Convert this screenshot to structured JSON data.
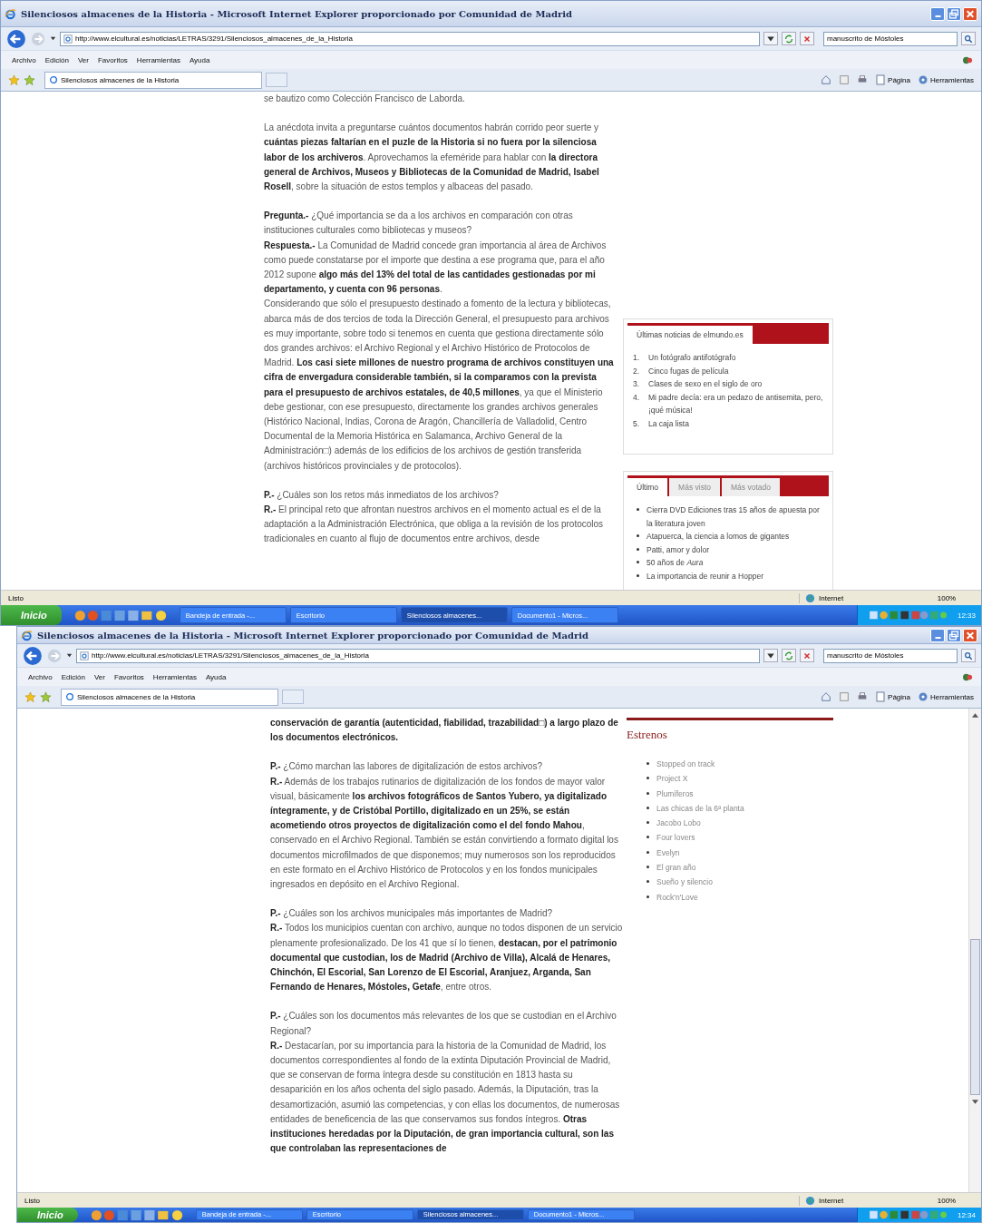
{
  "windows": [
    {
      "title": "Silenciosos almacenes de la Historia - Microsoft Internet Explorer proporcionado por Comunidad de Madrid",
      "address": "http://www.elcultural.es/noticias/LETRAS/3291/Silenciosos_almacenes_de_la_Historia",
      "search": "manuscrito de Móstoles",
      "menu": [
        "Archivo",
        "Edición",
        "Ver",
        "Favoritos",
        "Herramientas",
        "Ayuda"
      ],
      "tab": {
        "label": "Silenciosos almacenes de la Historia",
        "selected": true
      },
      "commands": [
        "Página",
        "Herramientas"
      ],
      "article": [
        [
          {
            "text": "se bautizo como Colección Francisco de Laborda.",
            "bold": false
          }
        ],
        [
          {
            "text": "La anécdota invita a preguntarse cuántos documentos habrán corrido peor suerte y **cuántas piezas faltarían en el puzle de la Historia si no fuera por la silenciosa labor de los archiveros**. Aprovechamos la efeméride para hablar con **la directora general de Archivos, Museos y Bibliotecas de la Comunidad de Madrid, Isabel Rosell**, sobre la situación de estos templos y albaceas del pasado.",
            "bold": false
          }
        ],
        [
          {
            "text": "**Pregunta.-** ¿Qué importancia se da a los archivos en comparación con otras instituciones culturales como bibliotecas y museos?",
            "bold": false
          },
          {
            "text": "**Respuesta.-** La Comunidad de Madrid concede gran importancia al área de Archivos como puede constatarse por el importe que destina a ese programa que, para el año 2012 supone **algo más del 13% del total de las cantidades gestionadas por mi departamento, y cuenta con 96 personas**.",
            "bold": false
          },
          {
            "text": "Considerando que sólo el presupuesto destinado a fomento de la lectura y bibliotecas, abarca más de dos tercios de toda la Dirección General, el presupuesto para archivos es muy importante, sobre todo si tenemos en cuenta que gestiona directamente sólo dos grandes archivos: el Archivo Regional y el Archivo Histórico de Protocolos de Madrid. **Los casi siete millones de nuestro programa de archivos constituyen una cifra de envergadura considerable también, si la comparamos con la prevista para el presupuesto de archivos estatales, de 40,5 millones**, ya que el Ministerio debe gestionar, con ese presupuesto, directamente los grandes archivos generales (Histórico Nacional, Indias, Corona de Aragón, Chancillería de Valladolid, Centro Documental de la Memoria Histórica en Salamanca, Archivo General de la Administración□) además de los edificios de los archivos de gestión transferida (archivos históricos provinciales y de protocolos).",
            "bold": false
          }
        ],
        [
          {
            "text": "**P.-** ¿Cuáles son los retos más inmediatos de los archivos?",
            "bold": false
          },
          {
            "text": "**R.-** El principal reto que afrontan nuestros archivos en el momento actual es el de la adaptación a la Administración Electrónica, que obliga a la revisión de los protocolos tradicionales en cuanto al flujo de documentos entre archivos, desde",
            "bold": false
          }
        ]
      ],
      "sidebar": [
        {
          "kind": "tabbed_box",
          "tabs": [
            {
              "label": "Últimas noticias de elmundo.es",
              "selected": true
            }
          ],
          "items": [
            {
              "number": "1.",
              "text": "Un fotógrafo antifotógrafo"
            },
            {
              "number": "2.",
              "text": "Cinco fugas de película"
            },
            {
              "number": "3.",
              "text": "Clases de sexo en el siglo de oro"
            },
            {
              "number": "4.",
              "text": "Mi padre decía: era un pedazo de antisemita, pero, ¡qué música!"
            },
            {
              "number": "5.",
              "text": "La caja lista"
            }
          ]
        },
        {
          "kind": "tabbed_box",
          "tabs": [
            {
              "label": "Último",
              "selected": true
            },
            {
              "label": "Más visto",
              "selected": false
            },
            {
              "label": "Más votado",
              "selected": false
            }
          ],
          "items": [
            {
              "text": "Cierra DVD Ediciones tras 15 años de apuesta por la literatura joven"
            },
            {
              "text": "Atapuerca, la ciencia a lomos de gigantes"
            },
            {
              "text": "Patti, amor y dolor"
            },
            {
              "text": "50 años de *Aura*"
            },
            {
              "text": "La importancia de reunir a Hopper"
            }
          ]
        }
      ],
      "status": {
        "text": "Listo",
        "zone": "Internet",
        "zoom": "100%"
      },
      "taskbar": {
        "start": "Inicio",
        "tasks": [
          {
            "label": "Bandeja de entrada -...",
            "selected": false
          },
          {
            "label": "Escritorio",
            "selected": false
          },
          {
            "label": "Silenciosos almacenes...",
            "selected": true
          },
          {
            "label": "Documento1 - Micros...",
            "selected": false
          }
        ],
        "clock": "12:33"
      }
    },
    {
      "title": "Silenciosos almacenes de la Historia - Microsoft Internet Explorer proporcionado por Comunidad de Madrid",
      "address": "http://www.elcultural.es/noticias/LETRAS/3291/Silenciosos_almacenes_de_la_Historia",
      "search": "manuscrito de Móstoles",
      "menu": [
        "Archivo",
        "Edición",
        "Ver",
        "Favoritos",
        "Herramientas",
        "Ayuda"
      ],
      "tab": {
        "label": "Silenciosos almacenes de la Historia",
        "selected": true
      },
      "commands": [
        "Página",
        "Herramientas"
      ],
      "article": [
        [
          {
            "text": "conservación de garantía (autenticidad, fiabilidad, trazabilidad□) a largo plazo de los documentos electrónicos.",
            "bold": true
          }
        ],
        [
          {
            "text": "**P.-** ¿Cómo marchan las labores de digitalización de estos archivos?",
            "bold": false
          },
          {
            "text": "**R.-** Además de los trabajos rutinarios de digitalización de los fondos de mayor valor visual, básicamente **los archivos fotográficos de Santos Yubero, ya digitalizado íntegramente, y de Cristóbal Portillo, digitalizado en un 25%, se están acometiendo otros proyectos de digitalización como el del fondo Mahou**, conservado en el Archivo Regional. También se están convirtiendo a formato digital los documentos microfilmados de que disponemos; muy numerosos son los reproducidos en este formato en el Archivo Histórico de Protocolos y en los fondos municipales ingresados en depósito en el Archivo Regional.",
            "bold": false
          }
        ],
        [
          {
            "text": "**P.-** ¿Cuáles son los archivos municipales más importantes de Madrid?",
            "bold": false
          },
          {
            "text": "**R.-** Todos los municipios cuentan con archivo, aunque no todos disponen de un servicio plenamente profesionalizado. De los 41 que sí lo tienen, **destacan, por el patrimonio documental que custodian, los de Madrid (Archivo de Villa), Alcalá de Henares, Chinchón, El Escorial, San Lorenzo de El Escorial, Aranjuez, Arganda, San Fernando de Henares, Móstoles, Getafe**, entre otros.",
            "bold": false
          }
        ],
        [
          {
            "text": "**P.-** ¿Cuáles son los documentos más relevantes de los que se custodian en el Archivo Regional?",
            "bold": false
          },
          {
            "text": "**R.-** Destacarían, por su importancia para la historia de la Comunidad de Madrid, los documentos correspondientes al fondo de la extinta Diputación Provincial de Madrid, que se conservan de forma íntegra desde su constitución en 1813 hasta su desaparición en los años ochenta del siglo pasado. Además, la Diputación, tras la desamortización, asumió las competencias, y con ellas los documentos, de numerosas entidades de beneficencia de las que conservamos sus fondos íntegros. **Otras instituciones heredadas por la Diputación, de gran importancia cultural, son las que controlaban las representaciones de**",
            "bold": false
          }
        ]
      ],
      "sidebar": [
        {
          "kind": "heading_list",
          "heading": "Estrenos",
          "items": [
            {
              "text": "Stopped on track"
            },
            {
              "text": "Project X"
            },
            {
              "text": "Plumíferos"
            },
            {
              "text": "Las chicas de la 6ª planta"
            },
            {
              "text": "Jacobo Lobo"
            },
            {
              "text": "Four lovers"
            },
            {
              "text": "Evelyn"
            },
            {
              "text": "El gran año"
            },
            {
              "text": "Sueño y silencio"
            },
            {
              "text": "Rock'n'Love"
            }
          ]
        }
      ],
      "status": {
        "text": "Listo",
        "zone": "Internet",
        "zoom": "100%"
      },
      "taskbar": {
        "start": "Inicio",
        "tasks": [
          {
            "label": "Bandeja de entrada -...",
            "selected": false
          },
          {
            "label": "Escritorio",
            "selected": false
          },
          {
            "label": "Silenciosos almacenes...",
            "selected": true
          },
          {
            "label": "Documento1 - Micros...",
            "selected": false
          }
        ],
        "clock": "12:34"
      }
    }
  ]
}
